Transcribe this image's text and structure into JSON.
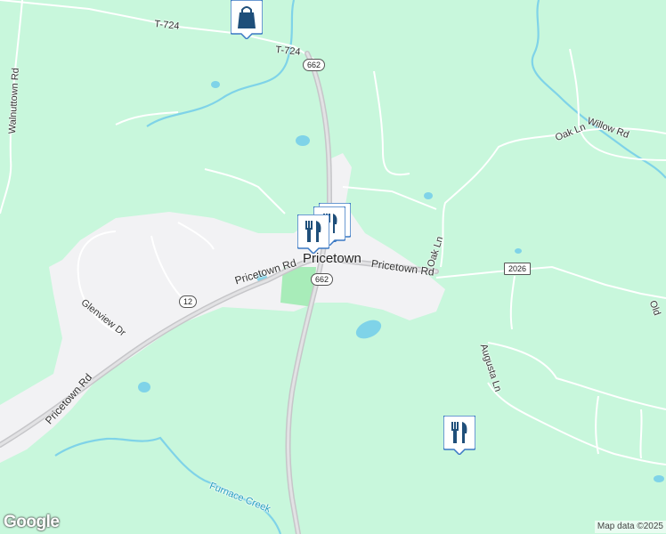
{
  "colors": {
    "land": "#c8f7dc",
    "urban": "#f2f2f4",
    "park": "#a8ecb9",
    "water": "#7fd3e8",
    "highway": "#c6c6c9",
    "road": "#ffffff"
  },
  "town": {
    "name": "Pricetown"
  },
  "roads": {
    "t724_a": "T-724",
    "t724_b": "T-724",
    "walnuttown": "Walnuttown Rd",
    "oak_ln_ne": "Oak Ln",
    "willow": "Willow Rd",
    "oak_ln": "Oak Ln",
    "pricetown_rd_w": "Pricetown Rd",
    "pricetown_rd_e": "Pricetown Rd",
    "pricetown_rd_sw": "Pricetown Rd",
    "glenview": "Glenview Dr",
    "augusta": "Augusta Ln",
    "edge": "Old"
  },
  "shields": {
    "r662_n": "662",
    "r662_s": "662",
    "r12": "12",
    "r2026": "2026"
  },
  "water": {
    "creek": "Furnace Creek"
  },
  "markers": [
    {
      "icon": "shopping-bag-icon",
      "label": "shopping"
    },
    {
      "icon": "restaurant-icon",
      "label": "restaurant"
    },
    {
      "icon": "restaurant-icon",
      "label": "restaurant"
    },
    {
      "icon": "restaurant-icon",
      "label": "restaurant"
    },
    {
      "icon": "restaurant-icon",
      "label": "restaurant"
    }
  ],
  "logo": "Google",
  "attribution": "Map data ©2025"
}
